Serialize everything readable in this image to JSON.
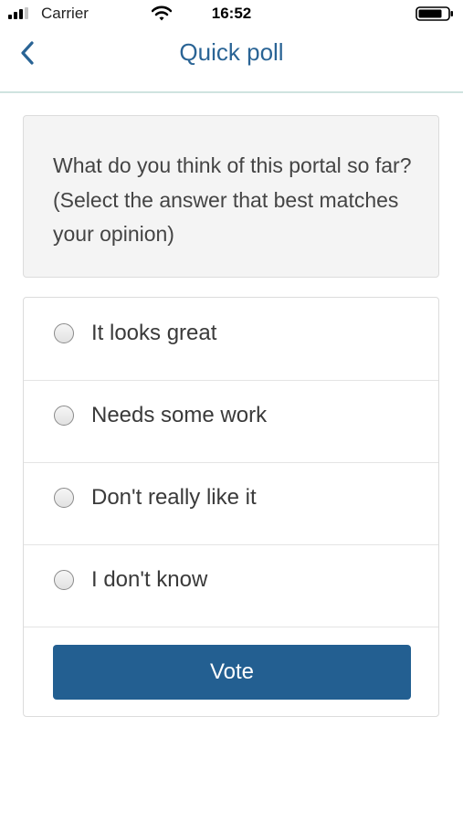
{
  "status_bar": {
    "carrier": "Carrier",
    "time": "16:52",
    "icons": [
      "signal-icon",
      "wifi-icon",
      "battery-icon"
    ]
  },
  "nav": {
    "back_icon": "chevron-left-icon",
    "title": "Quick poll"
  },
  "question": {
    "text": "What do you think of this portal so far? (Select the answer that best matches your opinion)"
  },
  "options": [
    {
      "label": "It looks great",
      "selected": false
    },
    {
      "label": "Needs some work",
      "selected": false
    },
    {
      "label": "Don't really like it",
      "selected": false
    },
    {
      "label": "I don't know",
      "selected": false
    }
  ],
  "vote_button": {
    "label": "Vote"
  },
  "colors": {
    "accent": "#2a6495",
    "button": "#235f91",
    "nav_divider": "#cfe3e0",
    "card_background": "#f4f4f4"
  }
}
